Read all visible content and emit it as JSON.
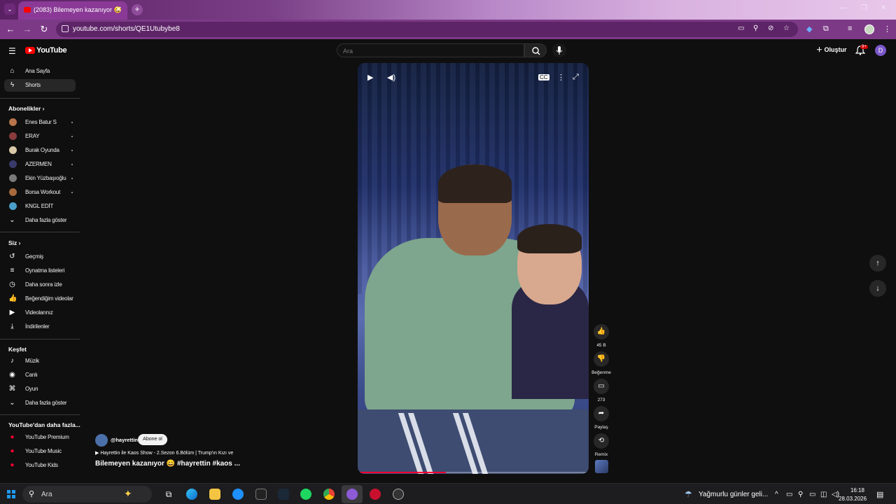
{
  "browser": {
    "tab_title": "(2083) Bilemeyen kazanıyor 😄",
    "tab_close": "✕",
    "new_tab": "+",
    "url": "youtube.com/shorts/QE1Utubybe8",
    "minimize": "—",
    "restore": "❐",
    "close": "✕"
  },
  "header": {
    "logo": "YouTube",
    "search_placeholder": "Ara",
    "create_label": "Oluştur",
    "notif_badge": "9+",
    "avatar_letter": "D"
  },
  "sidebar": {
    "main": [
      {
        "label": "Ana Sayfa",
        "icon": "home-icon"
      },
      {
        "label": "Shorts",
        "icon": "shorts-icon"
      }
    ],
    "subs_heading": "Abonelikler",
    "subs": [
      {
        "label": "Enes Batur S",
        "color": "#b8744a"
      },
      {
        "label": "ERAY",
        "color": "#8a3c3c"
      },
      {
        "label": "Burak Oyunda",
        "color": "#d9c9a8"
      },
      {
        "label": "AZERMEN",
        "color": "#3a3a6a"
      },
      {
        "label": "Ekin Yüzbaşıoğlu",
        "color": "#7a7a7a"
      },
      {
        "label": "Borsa Workout",
        "color": "#a86a3c"
      },
      {
        "label": "KNGL EDİT",
        "color": "#4aa0c8"
      }
    ],
    "subs_more": "Daha fazla göster",
    "you_heading": "Siz",
    "you": [
      {
        "label": "Geçmiş",
        "icon": "history-icon"
      },
      {
        "label": "Oynatma listeleri",
        "icon": "playlists-icon"
      },
      {
        "label": "Daha sonra izle",
        "icon": "watch-later-icon"
      },
      {
        "label": "Beğendiğim videolar",
        "icon": "liked-icon"
      },
      {
        "label": "Videolarınız",
        "icon": "your-videos-icon"
      },
      {
        "label": "İndirilenler",
        "icon": "downloads-icon"
      }
    ],
    "explore_heading": "Keşfet",
    "explore": [
      {
        "label": "Müzik",
        "icon": "music-icon"
      },
      {
        "label": "Canlı",
        "icon": "live-icon"
      },
      {
        "label": "Oyun",
        "icon": "gaming-icon"
      }
    ],
    "explore_more": "Daha fazla göster",
    "more_heading": "YouTube'dan daha fazla...",
    "more": [
      {
        "label": "YouTube Premium"
      },
      {
        "label": "YouTube Music"
      },
      {
        "label": "YouTube Kids"
      }
    ]
  },
  "short": {
    "channel": "@hayrettin",
    "subscribe": "Abone ol",
    "playlist": "Hayrettin ile Kaos Show - 2.Sezon 6.Bölüm | Trump'ın Kızı ve",
    "caption": "Bilemeyen kazanıyor 😄 #hayrettin #kaos ...",
    "progress_fraction": 0.38,
    "likes": "45 B",
    "dislike": "Beğenme",
    "comments": "273",
    "share": "Paylaş",
    "remix": "Remix"
  },
  "taskbar": {
    "search": "Ara",
    "weather": "Yağmurlu günler geli...",
    "time": "16:18",
    "date": "28.03.2026"
  }
}
